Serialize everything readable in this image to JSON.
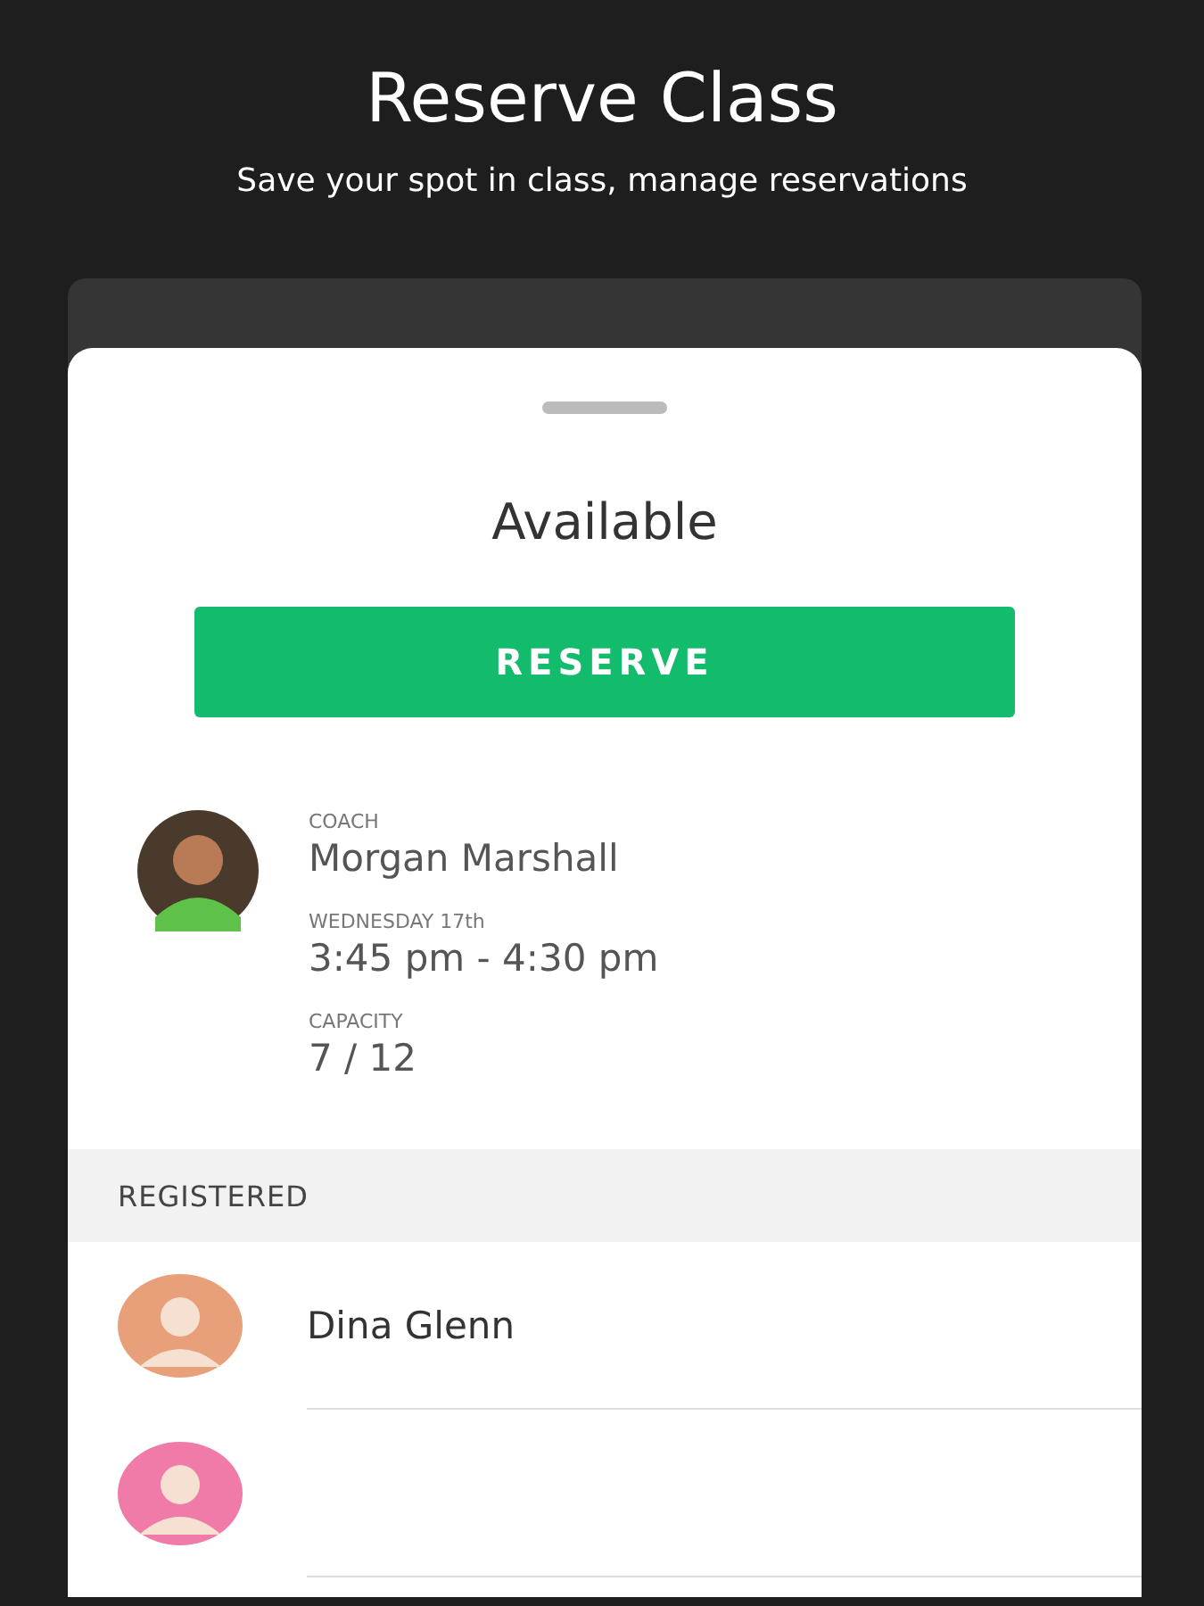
{
  "header": {
    "title": "Reserve Class",
    "subtitle": "Save your spot in class, manage reservations"
  },
  "sheet": {
    "status": "Available",
    "button": "RESERVE",
    "details": [
      {
        "label": "COACH",
        "value": "Morgan Marshall"
      },
      {
        "label": "WEDNESDAY 17th",
        "value": "3:45 pm - 4:30 pm"
      },
      {
        "label": "CAPACITY",
        "value": "7 / 12"
      }
    ],
    "registered": {
      "title": "REGISTERED",
      "people": [
        {
          "name": "Dina Glenn",
          "color": "#e8a07a"
        },
        {
          "color": "#f07aa8"
        }
      ]
    }
  }
}
